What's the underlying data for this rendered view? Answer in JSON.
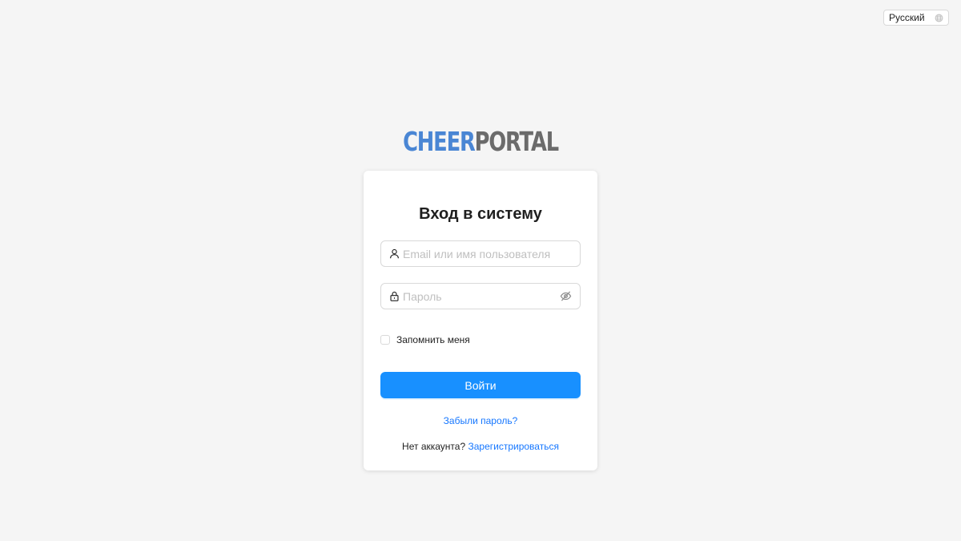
{
  "language": {
    "selected": "Русский",
    "icon": "globe-icon"
  },
  "logo": {
    "part1": "CHEER",
    "part2": "PORTAL"
  },
  "login": {
    "title": "Вход в систему",
    "username_placeholder": "Email или имя пользователя",
    "username_value": "",
    "username_icon": "user-icon",
    "password_placeholder": "Пароль",
    "password_value": "",
    "password_icon": "lock-icon",
    "password_toggle_icon": "eye-invisible-icon",
    "remember_label": "Запомнить меня",
    "remember_checked": false,
    "submit_label": "Войти",
    "forgot_label": "Забыли пароль?",
    "no_account_text": "Нет аккаунта?",
    "register_label": "Зарегистрироваться"
  },
  "colors": {
    "accent": "#1890ff",
    "link": "#1677ff",
    "logo_primary": "#4a86d4",
    "logo_secondary": "#6b6b6b",
    "background": "#f5f5f5"
  }
}
